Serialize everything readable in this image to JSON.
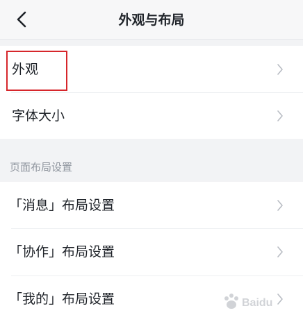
{
  "header": {
    "title": "外观与布局"
  },
  "groups": [
    {
      "items": [
        {
          "label": "外观"
        },
        {
          "label": "字体大小"
        }
      ]
    },
    {
      "items": [
        {
          "label": "「消息」布局设置"
        },
        {
          "label": "「协作」布局设置"
        },
        {
          "label": "「我的」布局设置"
        }
      ]
    }
  ],
  "section": {
    "label": "页面布局设置"
  },
  "watermark": {
    "text": "Baidu"
  },
  "colors": {
    "highlight": "#d6262b",
    "background": "#f2f3f5",
    "section_text": "#8f959e",
    "chevron": "#b8bcc3"
  }
}
